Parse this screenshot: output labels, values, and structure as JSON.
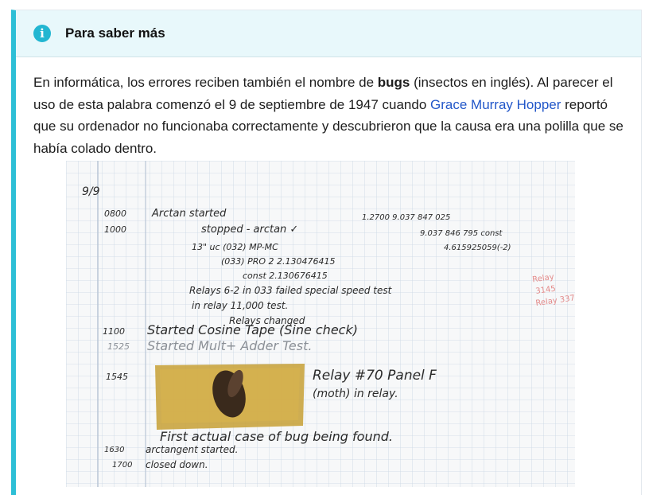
{
  "callout": {
    "title": "Para saber más",
    "icon": "info-icon",
    "accent_color": "#2dbfd6",
    "paragraph": {
      "part1": "En informática, los errores reciben también el nombre de ",
      "bold": "bugs",
      "part2": " (insectos en inglés). Al parecer el uso de esta palabra comenzó el 9 de septiembre de 1947 cuando ",
      "link": "Grace Murray Hopper",
      "part3": " reportó que su ordenador no funcionaba correctamente y descubrieron que la causa era una polilla que se había colado dentro."
    }
  },
  "logbook": {
    "date": "9/9",
    "lines": [
      {
        "time": "0800",
        "text": "Arctan started"
      },
      {
        "time": "1000",
        "text": "stopped - arctan ✓"
      },
      {
        "time": "",
        "text": "13\" uc (032) MP-MC"
      },
      {
        "time": "",
        "text": "(033) PRO 2    2.130476415"
      },
      {
        "time": "",
        "text": "const    2.130676415"
      },
      {
        "time": "",
        "text": "Relays 6-2 in 033 failed special speed test"
      },
      {
        "time": "",
        "text": "in relay    11,000 test."
      },
      {
        "time": "",
        "text": "Relays changed"
      },
      {
        "time": "1100",
        "text": "Started Cosine Tape (Sine check)"
      },
      {
        "time": "1525",
        "text": "Started Mult+ Adder Test."
      },
      {
        "time": "1545",
        "text": "Relay #70 Panel F"
      },
      {
        "time": "",
        "text": "(moth) in relay."
      },
      {
        "time": "",
        "text": "First actual case of bug being found."
      },
      {
        "time": "1630",
        "text": "arctangent started."
      },
      {
        "time": "1700",
        "text": "closed down."
      }
    ],
    "numbers": [
      "1.2700  9.037 847 025",
      "9.037 846 795 const",
      "4.615925059(-2)"
    ]
  }
}
